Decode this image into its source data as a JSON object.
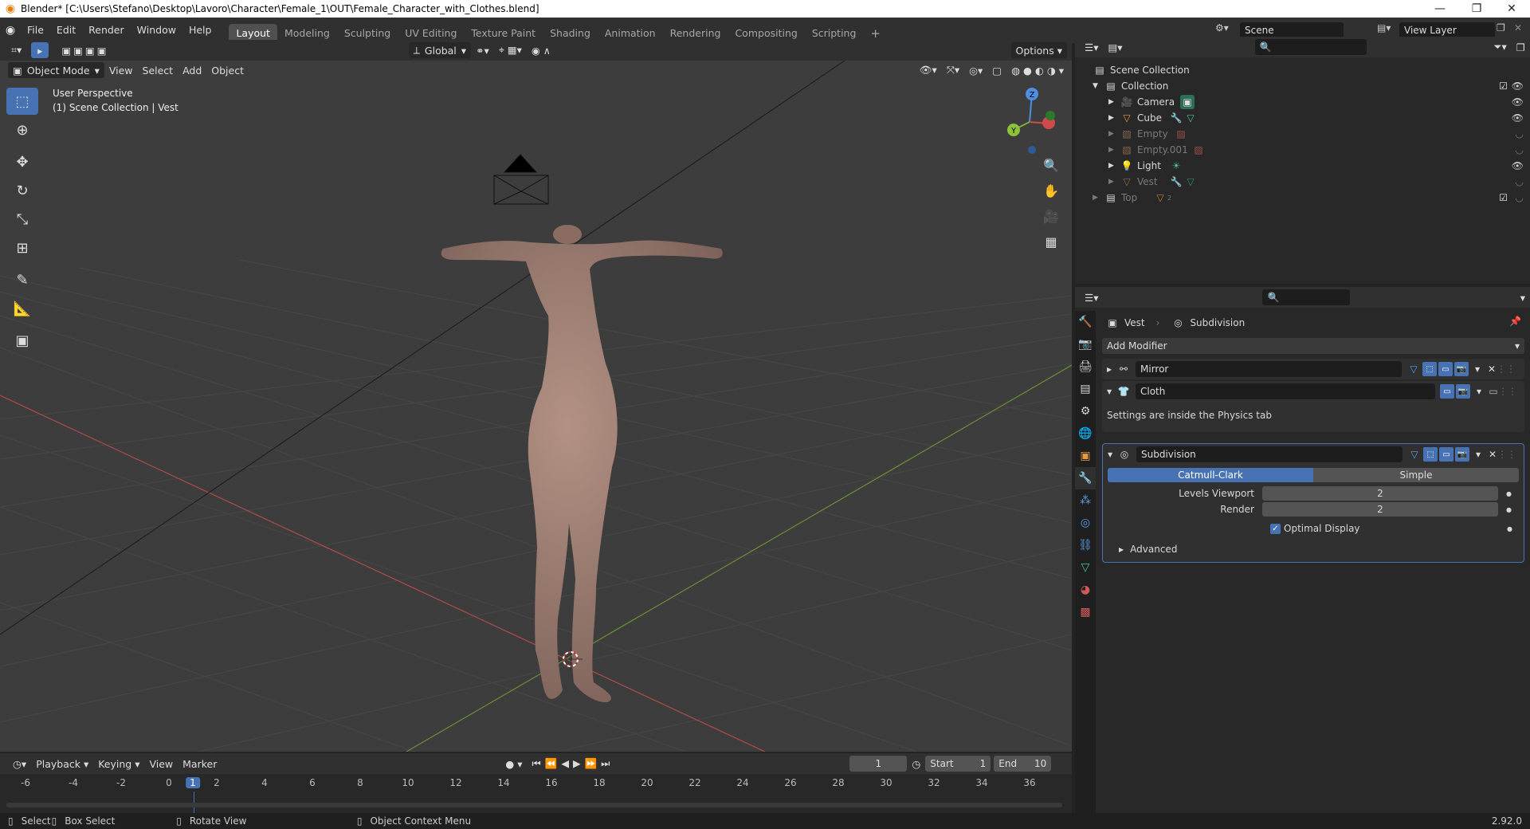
{
  "titlebar": {
    "title": "Blender* [C:\\Users\\Stefano\\Desktop\\Lavoro\\Character\\Female_1\\OUT\\Female_Character_with_Clothes.blend]"
  },
  "menu": {
    "file": "File",
    "edit": "Edit",
    "render": "Render",
    "window": "Window",
    "help": "Help"
  },
  "workspaces": [
    "Layout",
    "Modeling",
    "Sculpting",
    "UV Editing",
    "Texture Paint",
    "Shading",
    "Animation",
    "Rendering",
    "Compositing",
    "Scripting"
  ],
  "scene": {
    "name": "Scene",
    "view_layer": "View Layer"
  },
  "viewport_header": {
    "orientation": "Global",
    "options": "Options",
    "mode": "Object Mode",
    "view": "View",
    "select": "Select",
    "add": "Add",
    "object": "Object"
  },
  "viewport": {
    "perspective": "User Perspective",
    "context": "(1) Scene Collection | Vest"
  },
  "gizmo": {
    "z": "Z",
    "y": "Y"
  },
  "outliner": {
    "scene_collection": "Scene Collection",
    "collection": "Collection",
    "items": [
      {
        "name": "Camera",
        "dim": false
      },
      {
        "name": "Cube",
        "dim": false
      },
      {
        "name": "Empty",
        "dim": true
      },
      {
        "name": "Empty.001",
        "dim": true
      },
      {
        "name": "Light",
        "dim": false
      },
      {
        "name": "Vest",
        "dim": true
      }
    ],
    "top": "Top",
    "top_count": "2"
  },
  "properties": {
    "object": "Vest",
    "modifier_crumb": "Subdivision",
    "add_modifier": "Add Modifier",
    "mirror": "Mirror",
    "cloth": "Cloth",
    "cloth_note": "Settings are inside the Physics tab",
    "subdivision": "Subdivision",
    "catmull": "Catmull-Clark",
    "simple": "Simple",
    "levels_viewport_label": "Levels Viewport",
    "levels_viewport": "2",
    "render_label": "Render",
    "render_value": "2",
    "optimal_display": "Optimal Display",
    "advanced": "Advanced"
  },
  "timeline": {
    "playback": "Playback",
    "keying": "Keying",
    "view": "View",
    "marker": "Marker",
    "current_frame": "1",
    "start_label": "Start",
    "start": "1",
    "end_label": "End",
    "end": "10",
    "ruler": [
      "-6",
      "-4",
      "-2",
      "0",
      "1",
      "2",
      "4",
      "6",
      "8",
      "10",
      "12",
      "14",
      "16",
      "18",
      "20",
      "22",
      "24",
      "26",
      "28",
      "30",
      "32",
      "34",
      "36"
    ]
  },
  "status": {
    "select": "Select",
    "box_select": "Box Select",
    "rotate": "Rotate View",
    "context_menu": "Object Context Menu",
    "version": "2.92.0"
  }
}
